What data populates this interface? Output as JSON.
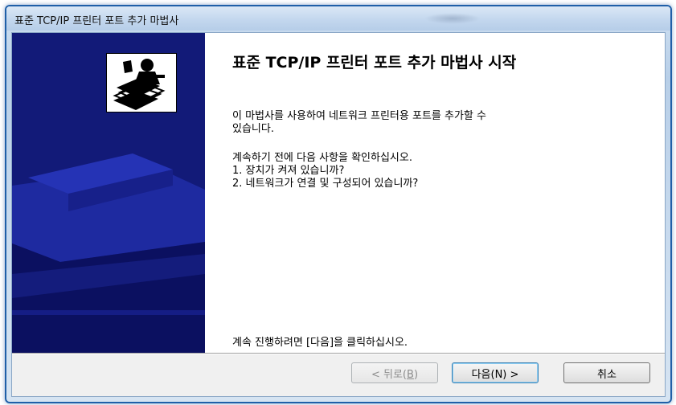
{
  "window": {
    "title": "표준 TCP/IP 프린터 포트 추가 마법사"
  },
  "banner": {
    "icon": "printer-port-wizard-icon"
  },
  "content": {
    "heading": "표준 TCP/IP 프린터 포트 추가 마법사 시작",
    "intro_line1": "이 마법사를 사용하여 네트워크 프린터용 포트를 추가할 수",
    "intro_line2": "있습니다.",
    "check_intro": "계속하기 전에 다음 사항을 확인하십시오.",
    "check_1": "1.  장치가 켜져 있습니까?",
    "check_2": "2.  네트워크가 연결 및 구성되어 있습니까?",
    "continue_text": "계속 진행하려면 [다음]을 클릭하십시오."
  },
  "buttons": {
    "back_pre": "< 뒤로(",
    "back_mnemonic": "B",
    "back_post": ")",
    "next_label": "다음(N) >",
    "cancel_label": "취소"
  }
}
